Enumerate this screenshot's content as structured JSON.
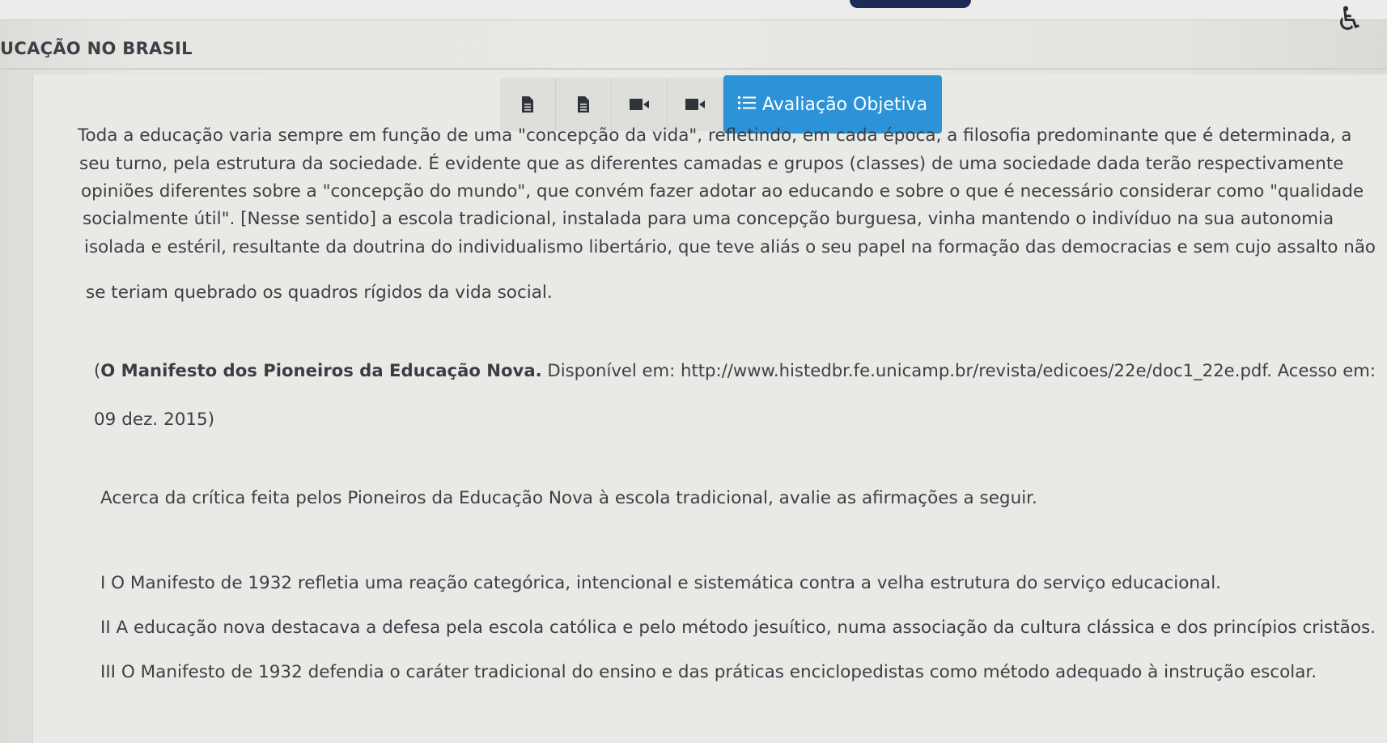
{
  "header": {
    "course_title": "UCAÇÃO NO BRASIL",
    "accessibility_icon": "accessibility-icon"
  },
  "toolbar": {
    "buttons": [
      {
        "icon": "document-icon"
      },
      {
        "icon": "document-icon"
      },
      {
        "icon": "video-icon"
      },
      {
        "icon": "video-icon"
      }
    ],
    "active_tab": {
      "icon": "list-icon",
      "label": "Avaliação Objetiva"
    }
  },
  "passage": {
    "lines": [
      "Toda a educação varia sempre em função de uma \"concepção da vida\", refletindo, em cada época, a filosofia predominante que é determinada, a",
      "seu turno, pela estrutura da sociedade. É evidente que as diferentes camadas e grupos (classes) de uma sociedade dada terão respectivamente",
      "opiniões diferentes sobre a \"concepção do mundo\", que convém fazer adotar ao educando e sobre o que é necessário considerar como \"qualidade",
      "socialmente útil\". [Nesse sentido] a escola tradicional, instalada para uma concepção burguesa, vinha mantendo o indivíduo na sua autonomia",
      "isolada e estéril, resultante da doutrina do individualismo libertário, que teve aliás o seu papel na formação das democracias e sem cujo assalto não",
      "se teriam quebrado os quadros rígidos da vida social."
    ]
  },
  "source": {
    "open_paren": "(",
    "bold_title": "O Manifesto dos Pioneiros da Educação Nova.",
    "rest": " Disponível em: http://www.histedbr.fe.unicamp.br/revista/edicoes/22e/doc1_22e.pdf. Acesso em:",
    "line2": "09 dez. 2015)"
  },
  "question": {
    "prompt": "Acerca da crítica feita pelos Pioneiros da Educação Nova à escola tradicional, avalie as afirmações a seguir.",
    "statements": [
      "I O Manifesto de 1932 refletia uma reação categórica, intencional e sistemática contra a velha estrutura do serviço educacional.",
      "II A educação nova destacava a defesa pela escola católica e pelo método jesuítico, numa associação da cultura clássica e dos princípios cristãos.",
      "III O Manifesto de 1932 defendia o caráter tradicional do ensino e das práticas enciclopedistas como método adequado à instrução escolar."
    ]
  },
  "colors": {
    "accent": "#2c93d8",
    "text": "#3c4046",
    "background": "#e8e9e4"
  }
}
